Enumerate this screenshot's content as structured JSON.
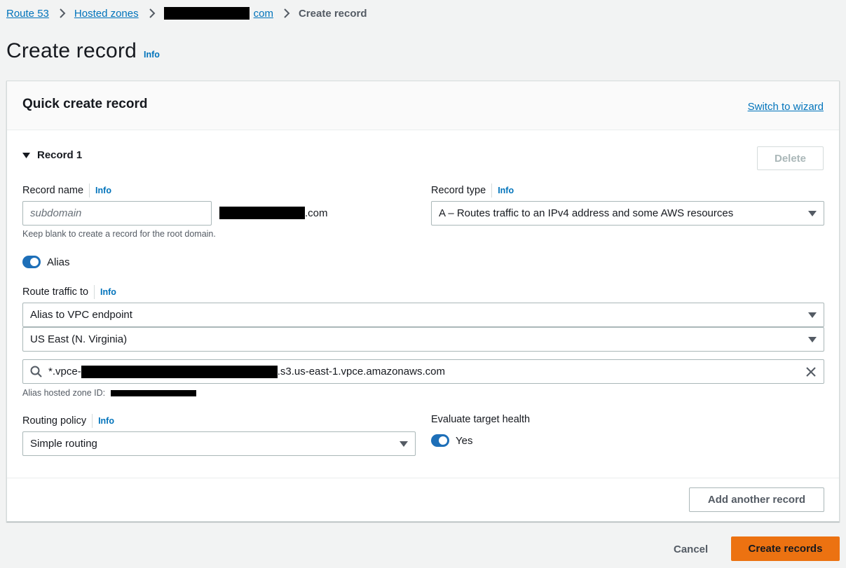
{
  "breadcrumb": {
    "items": [
      "Route 53",
      "Hosted zones",
      "com"
    ],
    "current": "Create record"
  },
  "page": {
    "title": "Create record",
    "info": "Info"
  },
  "panel": {
    "title": "Quick create record",
    "switch_link": "Switch to wizard"
  },
  "record": {
    "section_label": "Record 1",
    "delete_label": "Delete",
    "record_name": {
      "label": "Record name",
      "info": "Info",
      "placeholder": "subdomain",
      "suffix": ".com",
      "hint": "Keep blank to create a record for the root domain."
    },
    "record_type": {
      "label": "Record type",
      "info": "Info",
      "value": "A – Routes traffic to an IPv4 address and some AWS resources"
    },
    "alias": {
      "label": "Alias",
      "enabled": true
    },
    "route_traffic": {
      "label": "Route traffic to",
      "info": "Info",
      "endpoint_value": "Alias to VPC endpoint",
      "region_value": "US East (N. Virginia)",
      "search_prefix": "*.vpce-",
      "search_suffix": ".s3.us-east-1.vpce.amazonaws.com",
      "zone_id_label": "Alias hosted zone ID:"
    },
    "routing_policy": {
      "label": "Routing policy",
      "info": "Info",
      "value": "Simple routing"
    },
    "evaluate_health": {
      "label": "Evaluate target health",
      "value_label": "Yes",
      "enabled": true
    }
  },
  "actions": {
    "add_another": "Add another record",
    "cancel": "Cancel",
    "create": "Create records"
  },
  "colors": {
    "link": "#0073bb",
    "primary": "#ec7211",
    "toggle": "#1d6fb8",
    "background": "#f2f3f3"
  }
}
